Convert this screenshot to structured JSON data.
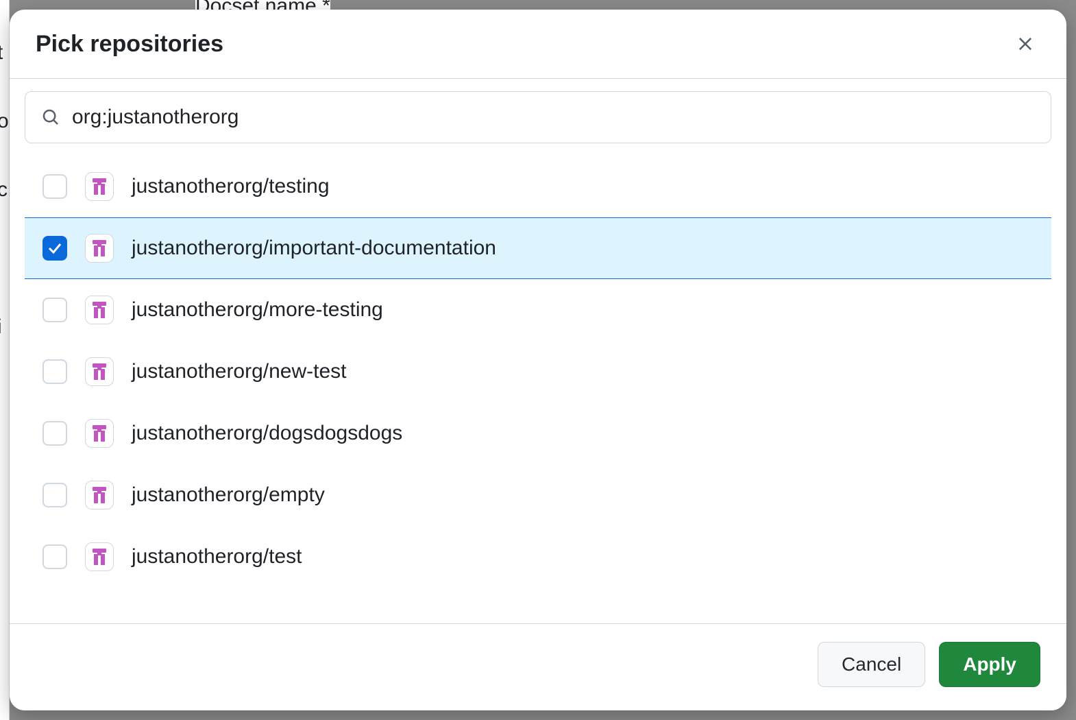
{
  "background": {
    "docset_label": "Docset name *",
    "left_chars": [
      "t",
      "o",
      "c",
      "i"
    ]
  },
  "modal": {
    "title": "Pick repositories",
    "search": {
      "value": "org:justanotherorg",
      "placeholder": ""
    },
    "repos": [
      {
        "name": "justanotherorg/testing",
        "checked": false
      },
      {
        "name": "justanotherorg/important-documentation",
        "checked": true
      },
      {
        "name": "justanotherorg/more-testing",
        "checked": false
      },
      {
        "name": "justanotherorg/new-test",
        "checked": false
      },
      {
        "name": "justanotherorg/dogsdogsdogs",
        "checked": false
      },
      {
        "name": "justanotherorg/empty",
        "checked": false
      },
      {
        "name": "justanotherorg/test",
        "checked": false
      }
    ],
    "footer": {
      "cancel": "Cancel",
      "apply": "Apply"
    }
  },
  "icons": {
    "avatar_color": "#c355c3"
  }
}
